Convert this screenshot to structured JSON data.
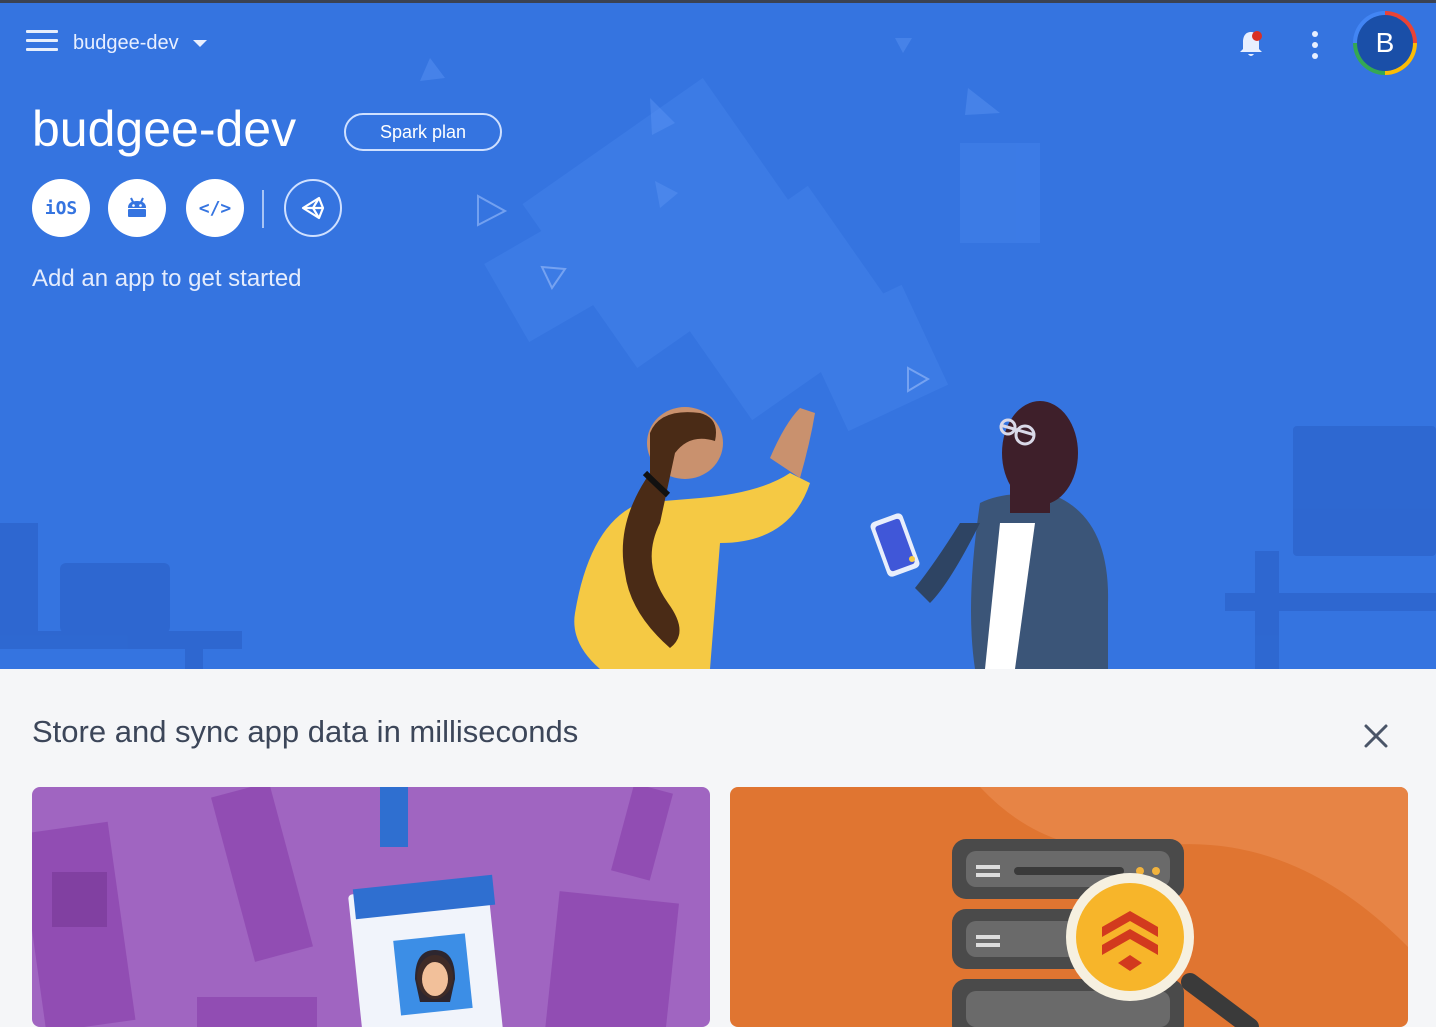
{
  "header": {
    "project_selector": "budgee-dev",
    "avatar_initial": "B"
  },
  "hero": {
    "title": "budgee-dev",
    "plan_badge": "Spark plan",
    "platforms": [
      {
        "label": "iOS",
        "icon": "ios-icon"
      },
      {
        "label": "",
        "icon": "android-icon"
      },
      {
        "label": "</>",
        "icon": "web-code-icon"
      },
      {
        "label": "",
        "icon": "unity-icon"
      }
    ],
    "subtitle": "Add an app to get started"
  },
  "promo": {
    "title": "Store and sync app data in milliseconds",
    "close_icon": "close-icon",
    "cards": [
      {
        "name": "authentication-card",
        "color": "#a065c1"
      },
      {
        "name": "database-card",
        "color": "#e07531"
      }
    ]
  },
  "colors": {
    "hero_bg": "#3574e0",
    "page_bg": "#f5f6f8",
    "accent_white": "#ffffff"
  }
}
